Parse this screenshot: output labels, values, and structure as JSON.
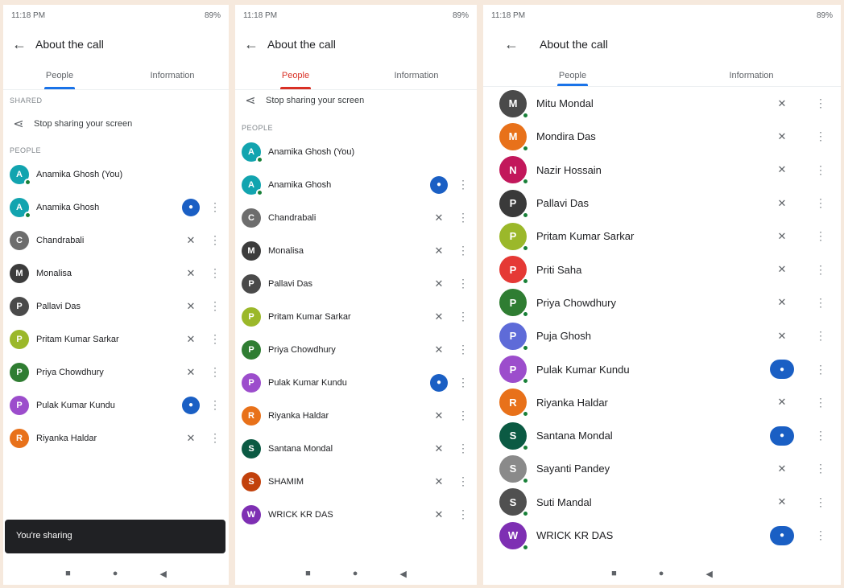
{
  "panel_left": {
    "status_left": "11:18 PM",
    "status_right": "89%",
    "title": "About the call",
    "tabs": [
      "People",
      "Information"
    ],
    "section_shared": "SHARED",
    "share_label": "Stop sharing your screen",
    "section_people": "PEOPLE",
    "rows": [
      {
        "name": "Anamika Ghosh (You)",
        "initial": "A",
        "color": "#12a4af",
        "dot": true,
        "icon": "",
        "menu": false
      },
      {
        "name": "Anamika Ghosh",
        "initial": "A",
        "color": "#12a4af",
        "dot": true,
        "icon": "cam",
        "menu": true
      },
      {
        "name": "Chandrabali",
        "initial": "C",
        "color": "#6d6d6d",
        "dot": false,
        "icon": "mic-off",
        "menu": true
      },
      {
        "name": "Monalisa",
        "initial": "M",
        "color": "#3c3c3c",
        "dot": false,
        "icon": "mic-off",
        "menu": true
      },
      {
        "name": "Pallavi Das",
        "initial": "P",
        "color": "#4a4a4a",
        "dot": false,
        "icon": "mic-off",
        "menu": true
      },
      {
        "name": "Pritam Kumar Sarkar",
        "initial": "P",
        "color": "#9bb82a",
        "dot": false,
        "icon": "mic-off",
        "menu": true
      },
      {
        "name": "Priya Chowdhury",
        "initial": "P",
        "color": "#2f7d32",
        "dot": false,
        "icon": "mic-off",
        "menu": true
      },
      {
        "name": "Pulak Kumar Kundu",
        "initial": "P",
        "color": "#9c4dcc",
        "dot": false,
        "icon": "cam",
        "menu": true
      },
      {
        "name": "Riyanka Haldar",
        "initial": "R",
        "color": "#e8711a",
        "dot": false,
        "icon": "mic-off",
        "menu": true
      }
    ],
    "snackbar": "You're sharing",
    "nav": [
      "■",
      "●",
      "◀"
    ]
  },
  "panel_mid": {
    "status_left": "11:18 PM",
    "status_right": "89%",
    "title": "About the call",
    "tabs": [
      "People",
      "Information"
    ],
    "share_label": "Stop sharing your screen",
    "section_people": "PEOPLE",
    "rows": [
      {
        "name": "Anamika Ghosh (You)",
        "initial": "A",
        "color": "#12a4af",
        "dot": true,
        "icon": "",
        "menu": false
      },
      {
        "name": "Anamika Ghosh",
        "initial": "A",
        "color": "#12a4af",
        "dot": true,
        "icon": "cam",
        "menu": true
      },
      {
        "name": "Chandrabali",
        "initial": "C",
        "color": "#6d6d6d",
        "dot": false,
        "icon": "mic-off",
        "menu": true
      },
      {
        "name": "Monalisa",
        "initial": "M",
        "color": "#3c3c3c",
        "dot": false,
        "icon": "mic-off",
        "menu": true
      },
      {
        "name": "Pallavi Das",
        "initial": "P",
        "color": "#4a4a4a",
        "dot": false,
        "icon": "mic-off",
        "menu": true
      },
      {
        "name": "Pritam Kumar Sarkar",
        "initial": "P",
        "color": "#9bb82a",
        "dot": false,
        "icon": "mic-off",
        "menu": true
      },
      {
        "name": "Priya Chowdhury",
        "initial": "P",
        "color": "#2f7d32",
        "dot": false,
        "icon": "mic-off",
        "menu": true
      },
      {
        "name": "Pulak Kumar Kundu",
        "initial": "P",
        "color": "#9c4dcc",
        "dot": false,
        "icon": "cam",
        "menu": true
      },
      {
        "name": "Riyanka Haldar",
        "initial": "R",
        "color": "#e8711a",
        "dot": false,
        "icon": "mic-off",
        "menu": true
      },
      {
        "name": "Santana Mondal",
        "initial": "S",
        "color": "#0b5a43",
        "dot": false,
        "icon": "mic-off",
        "menu": true
      },
      {
        "name": "SHAMIM",
        "initial": "S",
        "color": "#c2410c",
        "dot": false,
        "icon": "mic-off",
        "menu": true
      },
      {
        "name": "WRICK KR DAS",
        "initial": "W",
        "color": "#7e2fb3",
        "dot": false,
        "icon": "mic-off",
        "menu": true
      }
    ],
    "nav": [
      "■",
      "●",
      "◀"
    ]
  },
  "panel_right": {
    "status_left": "11:18 PM",
    "status_right": "89%",
    "title": "About the call",
    "tabs": [
      "People",
      "Information"
    ],
    "rows": [
      {
        "name": "Mitu Mondal",
        "initial": "M",
        "color": "#4a4a4a",
        "dot": true,
        "icon": "mic-off",
        "menu": true
      },
      {
        "name": "Mondira Das",
        "initial": "M",
        "color": "#e8711a",
        "dot": true,
        "icon": "mic-off",
        "menu": true
      },
      {
        "name": "Nazir Hossain",
        "initial": "N",
        "color": "#c2185b",
        "dot": true,
        "icon": "mic-off",
        "menu": true
      },
      {
        "name": "Pallavi Das",
        "initial": "P",
        "color": "#3a3a3a",
        "dot": true,
        "icon": "mic-off",
        "menu": true
      },
      {
        "name": "Pritam Kumar Sarkar",
        "initial": "P",
        "color": "#9bb82a",
        "dot": true,
        "icon": "mic-off",
        "menu": true
      },
      {
        "name": "Priti Saha",
        "initial": "P",
        "color": "#e53935",
        "dot": true,
        "icon": "mic-off",
        "menu": true
      },
      {
        "name": "Priya Chowdhury",
        "initial": "P",
        "color": "#2f7d32",
        "dot": true,
        "icon": "mic-off",
        "menu": true
      },
      {
        "name": "Puja Ghosh",
        "initial": "P",
        "color": "#5e6bd8",
        "dot": true,
        "icon": "mic-off",
        "menu": true
      },
      {
        "name": "Pulak Kumar Kundu",
        "initial": "P",
        "color": "#9c4dcc",
        "dot": true,
        "icon": "cam",
        "menu": true
      },
      {
        "name": "Riyanka Haldar",
        "initial": "R",
        "color": "#e8711a",
        "dot": true,
        "icon": "mic-off",
        "menu": true
      },
      {
        "name": "Santana Mondal",
        "initial": "S",
        "color": "#0b5a43",
        "dot": true,
        "icon": "cam",
        "menu": true
      },
      {
        "name": "Sayanti Pandey",
        "initial": "S",
        "color": "#8a8a8a",
        "dot": true,
        "icon": "mic-off",
        "menu": true
      },
      {
        "name": "Suti Mandal",
        "initial": "S",
        "color": "#505050",
        "dot": true,
        "icon": "mic-off",
        "menu": true
      },
      {
        "name": "WRICK KR DAS",
        "initial": "W",
        "color": "#7e2fb3",
        "dot": true,
        "icon": "cam",
        "menu": true
      }
    ],
    "nav": [
      "■",
      "●",
      "◀"
    ]
  }
}
